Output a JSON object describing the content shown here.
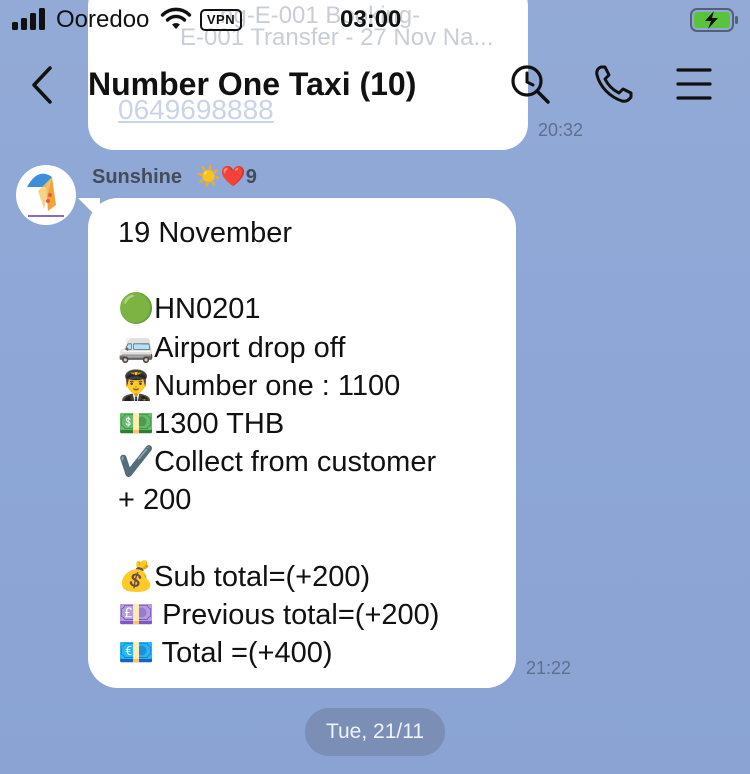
{
  "status_bar": {
    "carrier": "Ooredoo",
    "vpn_label": "VPN",
    "time": "03:00",
    "icons": [
      "signal-icon",
      "wifi-icon",
      "battery-charging-icon"
    ]
  },
  "previous_message": {
    "line1": "ng-E-001 Booking-",
    "line2": "E-001 Transfer - 27 Nov Na...",
    "phone": "0649698888",
    "time": "20:32"
  },
  "header": {
    "title": "Number One Taxi (10)",
    "icons": [
      "back-icon",
      "search-icon",
      "phone-icon",
      "menu-icon"
    ]
  },
  "message": {
    "sender": "Sunshine",
    "sender_badges": "☀️❤️9",
    "lines": [
      "19 November",
      "",
      "🟢HN0201",
      "🚐Airport drop off",
      "👨‍✈️Number one : 1100",
      "💵1300 THB",
      "✔️Collect from customer",
      "+ 200",
      "",
      "💰Sub total=(+200)",
      "💷 Previous total=(+200)",
      "💶 Total =(+400)"
    ],
    "time": "21:22"
  },
  "date_separator": "Tue, 21/11"
}
